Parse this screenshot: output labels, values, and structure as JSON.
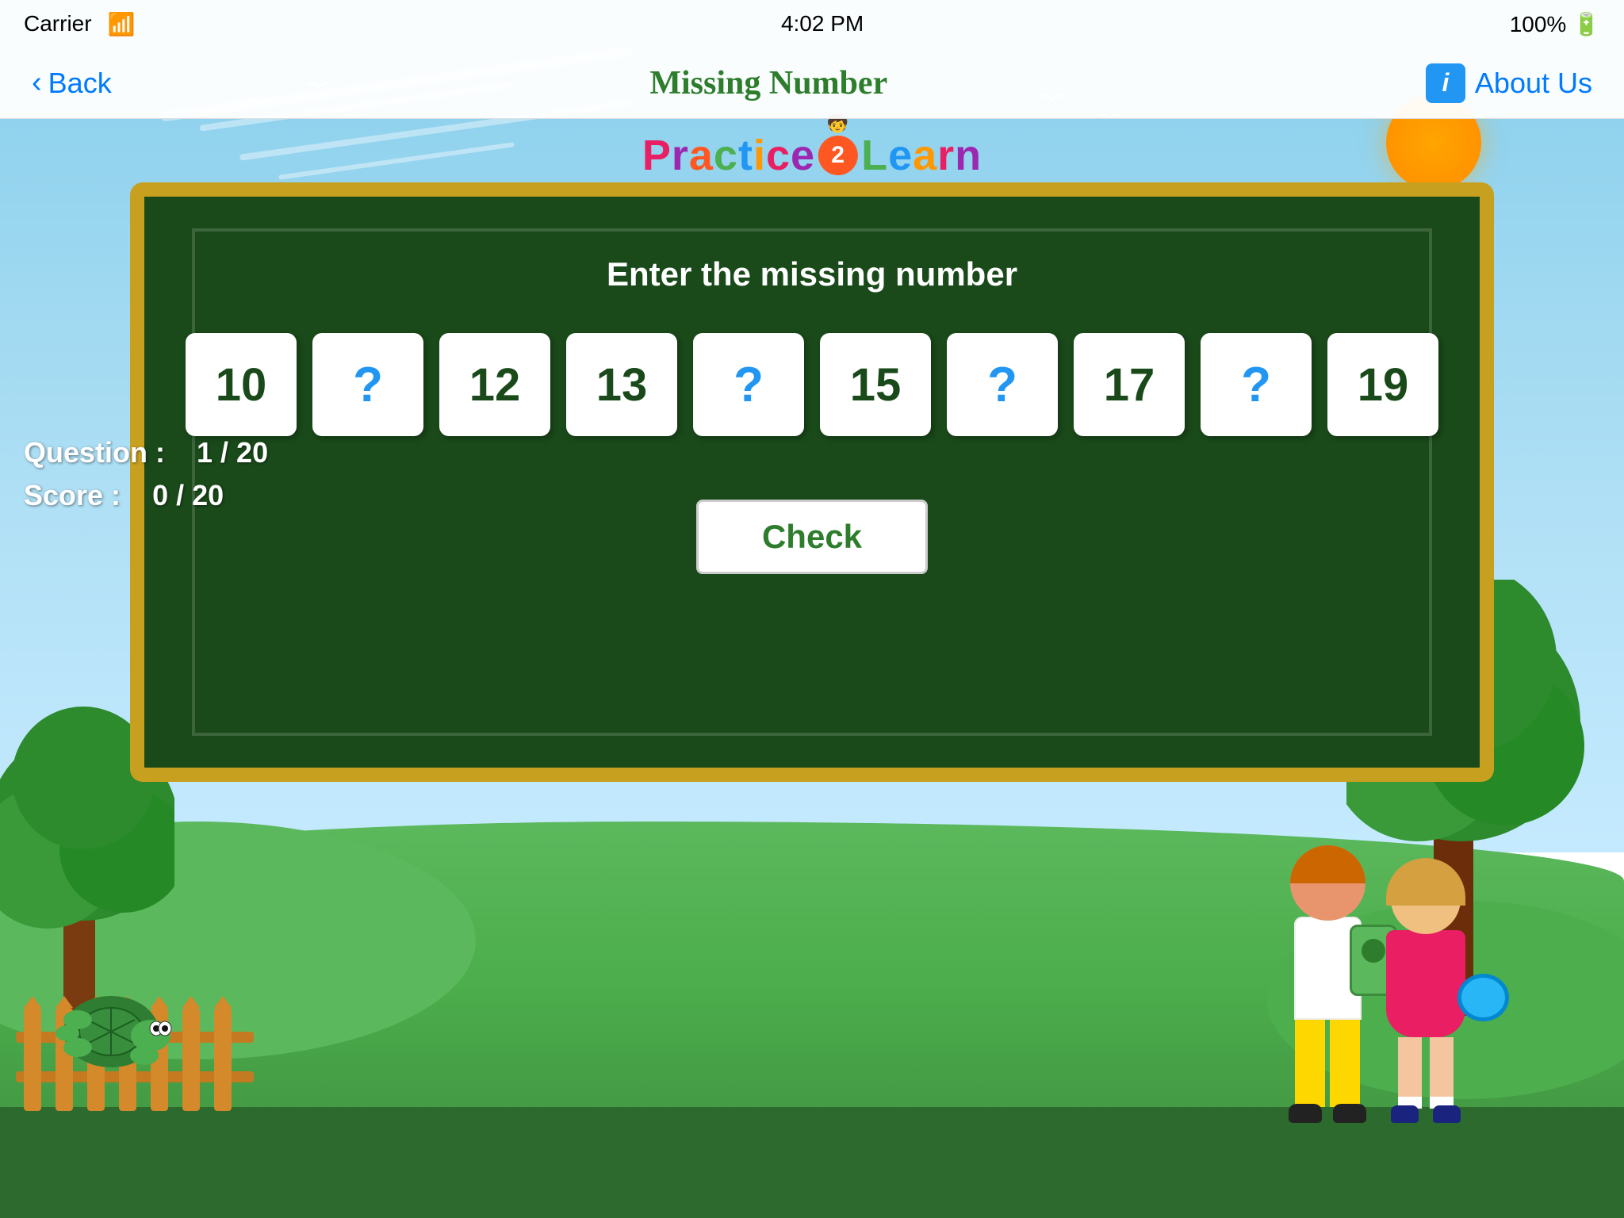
{
  "status_bar": {
    "carrier": "Carrier",
    "wifi_icon": "wifi",
    "time": "4:02 PM",
    "battery": "100%",
    "battery_icon": "battery-full"
  },
  "nav_bar": {
    "back_label": "Back",
    "title": "Missing Number",
    "about_us_label": "About Us",
    "info_icon_label": "i"
  },
  "logo": {
    "text": "Practice2Learn"
  },
  "chalkboard": {
    "instruction": "Enter the missing number",
    "tiles": [
      {
        "value": "10",
        "is_missing": false
      },
      {
        "value": "?",
        "is_missing": true
      },
      {
        "value": "12",
        "is_missing": false
      },
      {
        "value": "13",
        "is_missing": false
      },
      {
        "value": "?",
        "is_missing": true
      },
      {
        "value": "15",
        "is_missing": false
      },
      {
        "value": "?",
        "is_missing": true
      },
      {
        "value": "17",
        "is_missing": false
      },
      {
        "value": "?",
        "is_missing": true
      },
      {
        "value": "19",
        "is_missing": false
      }
    ],
    "check_button_label": "Check"
  },
  "score_panel": {
    "question_label": "Question :",
    "question_value": "1 / 20",
    "score_label": "Score :",
    "score_value": "0 / 20"
  },
  "colors": {
    "sky": "#87CEEB",
    "ground": "#5cb85c",
    "chalkboard_bg": "#1a4a1a",
    "chalkboard_border": "#c8a020",
    "nav_bg": "#f8f8f8",
    "back_blue": "#007AFF",
    "title_green": "#2d7d2d",
    "info_blue": "#2196F3"
  }
}
